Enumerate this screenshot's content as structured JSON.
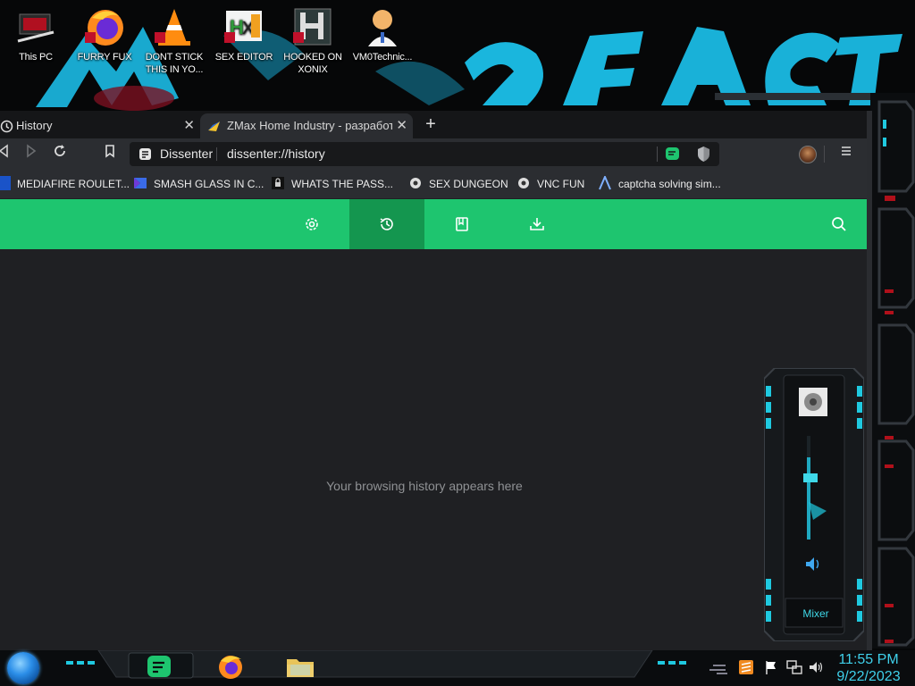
{
  "desktop": {
    "icons": [
      {
        "label": "This PC"
      },
      {
        "label": "FURRY FUX"
      },
      {
        "label": "DONT STICK THIS IN YO..."
      },
      {
        "label": "SEX EDITOR"
      },
      {
        "label": "HOOKED ON XONIX"
      },
      {
        "label": "VM0Technic..."
      }
    ]
  },
  "browser": {
    "tabs": [
      {
        "label": "History",
        "active": false
      },
      {
        "label": "ZMax Home Industry - разработк",
        "active": true
      }
    ],
    "address": {
      "site": "Dissenter",
      "url": "dissenter://history"
    },
    "bookmarks": [
      {
        "label": "MEDIAFIRE ROULET..."
      },
      {
        "label": "SMASH GLASS IN C..."
      },
      {
        "label": "WHATS THE PASS..."
      },
      {
        "label": "SEX DUNGEON"
      },
      {
        "label": "VNC FUN"
      },
      {
        "label": "captcha solving sim..."
      }
    ],
    "toolbar": {
      "items": [
        "settings-icon",
        "history-icon",
        "bookmarks-icon",
        "downloads-icon",
        "search-icon"
      ],
      "active": "history-icon"
    },
    "empty_message": "Your browsing history appears here",
    "accent_color": "#1ec56f"
  },
  "volume": {
    "mixer_label": "Mixer"
  },
  "taskbar": {
    "time": "11:55 PM",
    "date": "9/22/2023"
  }
}
